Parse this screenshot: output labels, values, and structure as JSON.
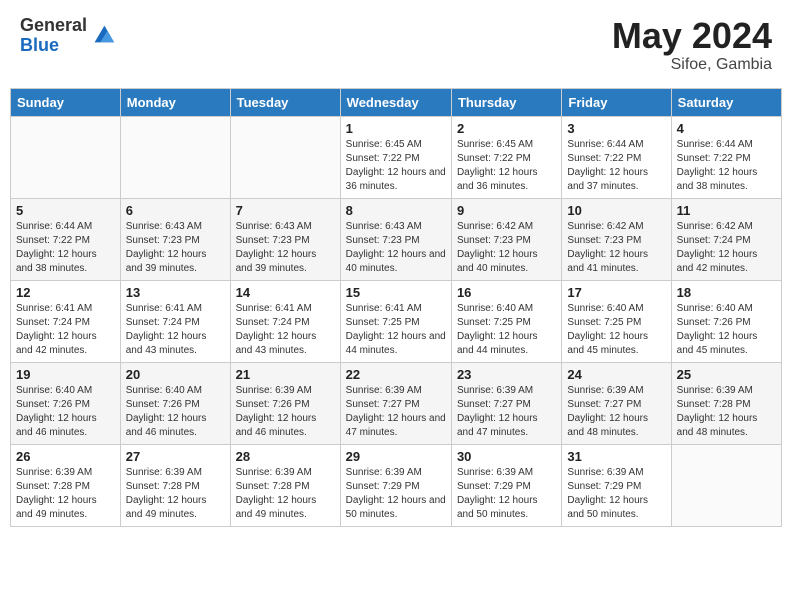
{
  "header": {
    "logo_general": "General",
    "logo_blue": "Blue",
    "title": "May 2024",
    "location": "Sifoe, Gambia"
  },
  "days_of_week": [
    "Sunday",
    "Monday",
    "Tuesday",
    "Wednesday",
    "Thursday",
    "Friday",
    "Saturday"
  ],
  "weeks": [
    [
      {
        "day": "",
        "sunrise": "",
        "sunset": "",
        "daylight": ""
      },
      {
        "day": "",
        "sunrise": "",
        "sunset": "",
        "daylight": ""
      },
      {
        "day": "",
        "sunrise": "",
        "sunset": "",
        "daylight": ""
      },
      {
        "day": "1",
        "sunrise": "Sunrise: 6:45 AM",
        "sunset": "Sunset: 7:22 PM",
        "daylight": "Daylight: 12 hours and 36 minutes."
      },
      {
        "day": "2",
        "sunrise": "Sunrise: 6:45 AM",
        "sunset": "Sunset: 7:22 PM",
        "daylight": "Daylight: 12 hours and 36 minutes."
      },
      {
        "day": "3",
        "sunrise": "Sunrise: 6:44 AM",
        "sunset": "Sunset: 7:22 PM",
        "daylight": "Daylight: 12 hours and 37 minutes."
      },
      {
        "day": "4",
        "sunrise": "Sunrise: 6:44 AM",
        "sunset": "Sunset: 7:22 PM",
        "daylight": "Daylight: 12 hours and 38 minutes."
      }
    ],
    [
      {
        "day": "5",
        "sunrise": "Sunrise: 6:44 AM",
        "sunset": "Sunset: 7:22 PM",
        "daylight": "Daylight: 12 hours and 38 minutes."
      },
      {
        "day": "6",
        "sunrise": "Sunrise: 6:43 AM",
        "sunset": "Sunset: 7:23 PM",
        "daylight": "Daylight: 12 hours and 39 minutes."
      },
      {
        "day": "7",
        "sunrise": "Sunrise: 6:43 AM",
        "sunset": "Sunset: 7:23 PM",
        "daylight": "Daylight: 12 hours and 39 minutes."
      },
      {
        "day": "8",
        "sunrise": "Sunrise: 6:43 AM",
        "sunset": "Sunset: 7:23 PM",
        "daylight": "Daylight: 12 hours and 40 minutes."
      },
      {
        "day": "9",
        "sunrise": "Sunrise: 6:42 AM",
        "sunset": "Sunset: 7:23 PM",
        "daylight": "Daylight: 12 hours and 40 minutes."
      },
      {
        "day": "10",
        "sunrise": "Sunrise: 6:42 AM",
        "sunset": "Sunset: 7:23 PM",
        "daylight": "Daylight: 12 hours and 41 minutes."
      },
      {
        "day": "11",
        "sunrise": "Sunrise: 6:42 AM",
        "sunset": "Sunset: 7:24 PM",
        "daylight": "Daylight: 12 hours and 42 minutes."
      }
    ],
    [
      {
        "day": "12",
        "sunrise": "Sunrise: 6:41 AM",
        "sunset": "Sunset: 7:24 PM",
        "daylight": "Daylight: 12 hours and 42 minutes."
      },
      {
        "day": "13",
        "sunrise": "Sunrise: 6:41 AM",
        "sunset": "Sunset: 7:24 PM",
        "daylight": "Daylight: 12 hours and 43 minutes."
      },
      {
        "day": "14",
        "sunrise": "Sunrise: 6:41 AM",
        "sunset": "Sunset: 7:24 PM",
        "daylight": "Daylight: 12 hours and 43 minutes."
      },
      {
        "day": "15",
        "sunrise": "Sunrise: 6:41 AM",
        "sunset": "Sunset: 7:25 PM",
        "daylight": "Daylight: 12 hours and 44 minutes."
      },
      {
        "day": "16",
        "sunrise": "Sunrise: 6:40 AM",
        "sunset": "Sunset: 7:25 PM",
        "daylight": "Daylight: 12 hours and 44 minutes."
      },
      {
        "day": "17",
        "sunrise": "Sunrise: 6:40 AM",
        "sunset": "Sunset: 7:25 PM",
        "daylight": "Daylight: 12 hours and 45 minutes."
      },
      {
        "day": "18",
        "sunrise": "Sunrise: 6:40 AM",
        "sunset": "Sunset: 7:26 PM",
        "daylight": "Daylight: 12 hours and 45 minutes."
      }
    ],
    [
      {
        "day": "19",
        "sunrise": "Sunrise: 6:40 AM",
        "sunset": "Sunset: 7:26 PM",
        "daylight": "Daylight: 12 hours and 46 minutes."
      },
      {
        "day": "20",
        "sunrise": "Sunrise: 6:40 AM",
        "sunset": "Sunset: 7:26 PM",
        "daylight": "Daylight: 12 hours and 46 minutes."
      },
      {
        "day": "21",
        "sunrise": "Sunrise: 6:39 AM",
        "sunset": "Sunset: 7:26 PM",
        "daylight": "Daylight: 12 hours and 46 minutes."
      },
      {
        "day": "22",
        "sunrise": "Sunrise: 6:39 AM",
        "sunset": "Sunset: 7:27 PM",
        "daylight": "Daylight: 12 hours and 47 minutes."
      },
      {
        "day": "23",
        "sunrise": "Sunrise: 6:39 AM",
        "sunset": "Sunset: 7:27 PM",
        "daylight": "Daylight: 12 hours and 47 minutes."
      },
      {
        "day": "24",
        "sunrise": "Sunrise: 6:39 AM",
        "sunset": "Sunset: 7:27 PM",
        "daylight": "Daylight: 12 hours and 48 minutes."
      },
      {
        "day": "25",
        "sunrise": "Sunrise: 6:39 AM",
        "sunset": "Sunset: 7:28 PM",
        "daylight": "Daylight: 12 hours and 48 minutes."
      }
    ],
    [
      {
        "day": "26",
        "sunrise": "Sunrise: 6:39 AM",
        "sunset": "Sunset: 7:28 PM",
        "daylight": "Daylight: 12 hours and 49 minutes."
      },
      {
        "day": "27",
        "sunrise": "Sunrise: 6:39 AM",
        "sunset": "Sunset: 7:28 PM",
        "daylight": "Daylight: 12 hours and 49 minutes."
      },
      {
        "day": "28",
        "sunrise": "Sunrise: 6:39 AM",
        "sunset": "Sunset: 7:28 PM",
        "daylight": "Daylight: 12 hours and 49 minutes."
      },
      {
        "day": "29",
        "sunrise": "Sunrise: 6:39 AM",
        "sunset": "Sunset: 7:29 PM",
        "daylight": "Daylight: 12 hours and 50 minutes."
      },
      {
        "day": "30",
        "sunrise": "Sunrise: 6:39 AM",
        "sunset": "Sunset: 7:29 PM",
        "daylight": "Daylight: 12 hours and 50 minutes."
      },
      {
        "day": "31",
        "sunrise": "Sunrise: 6:39 AM",
        "sunset": "Sunset: 7:29 PM",
        "daylight": "Daylight: 12 hours and 50 minutes."
      },
      {
        "day": "",
        "sunrise": "",
        "sunset": "",
        "daylight": ""
      }
    ]
  ]
}
